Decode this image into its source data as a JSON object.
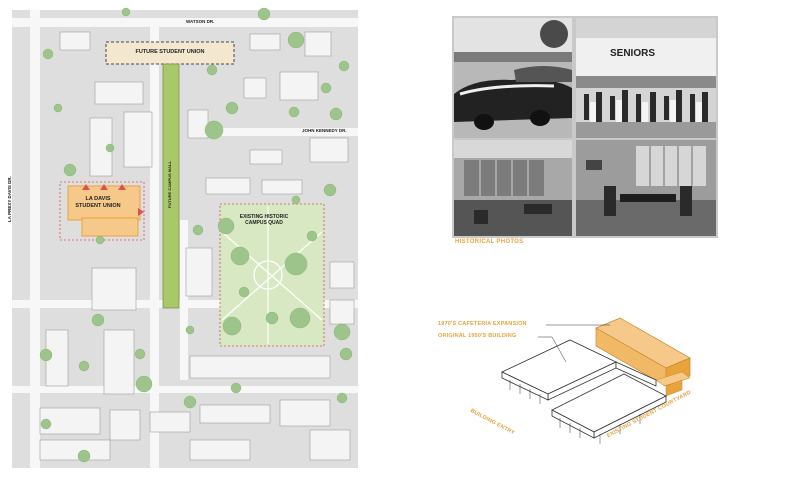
{
  "site_plan": {
    "streets": {
      "watson": "WATSON DR.",
      "john_kennedy": "JOHN KENNEDY DR.",
      "la_prexy": "LA PREXY DAVIS DR."
    },
    "future_student_union": "FUTURE STUDENT UNION",
    "future_campus_mall": "FUTURE CAMPUS MALL",
    "la_davis_union": "LA DAVIS\nSTUDENT UNION",
    "historic_quad": "EXISTING HISTORIC\nCAMPUS QUAD"
  },
  "photos": {
    "caption": "HISTORICAL PHOTOS",
    "sign_text": "SENIORS"
  },
  "axon": {
    "expansion": "1970'S CAFETERIA EXPANSION",
    "original": "ORIGINAL 1950'S BUILDING",
    "entry": "BUILDING ENTRY",
    "courtyard": "EXISTING STUDENT COURTYARD"
  },
  "colors": {
    "accent_orange": "#e8a33c",
    "union_fill": "#f6c98a",
    "future_union_fill": "#f3e8cf",
    "mall_green": "#a9c86a",
    "quad_green": "#d8e8c3",
    "tree_green": "#9cc48b",
    "red_dash": "#d9534f"
  }
}
